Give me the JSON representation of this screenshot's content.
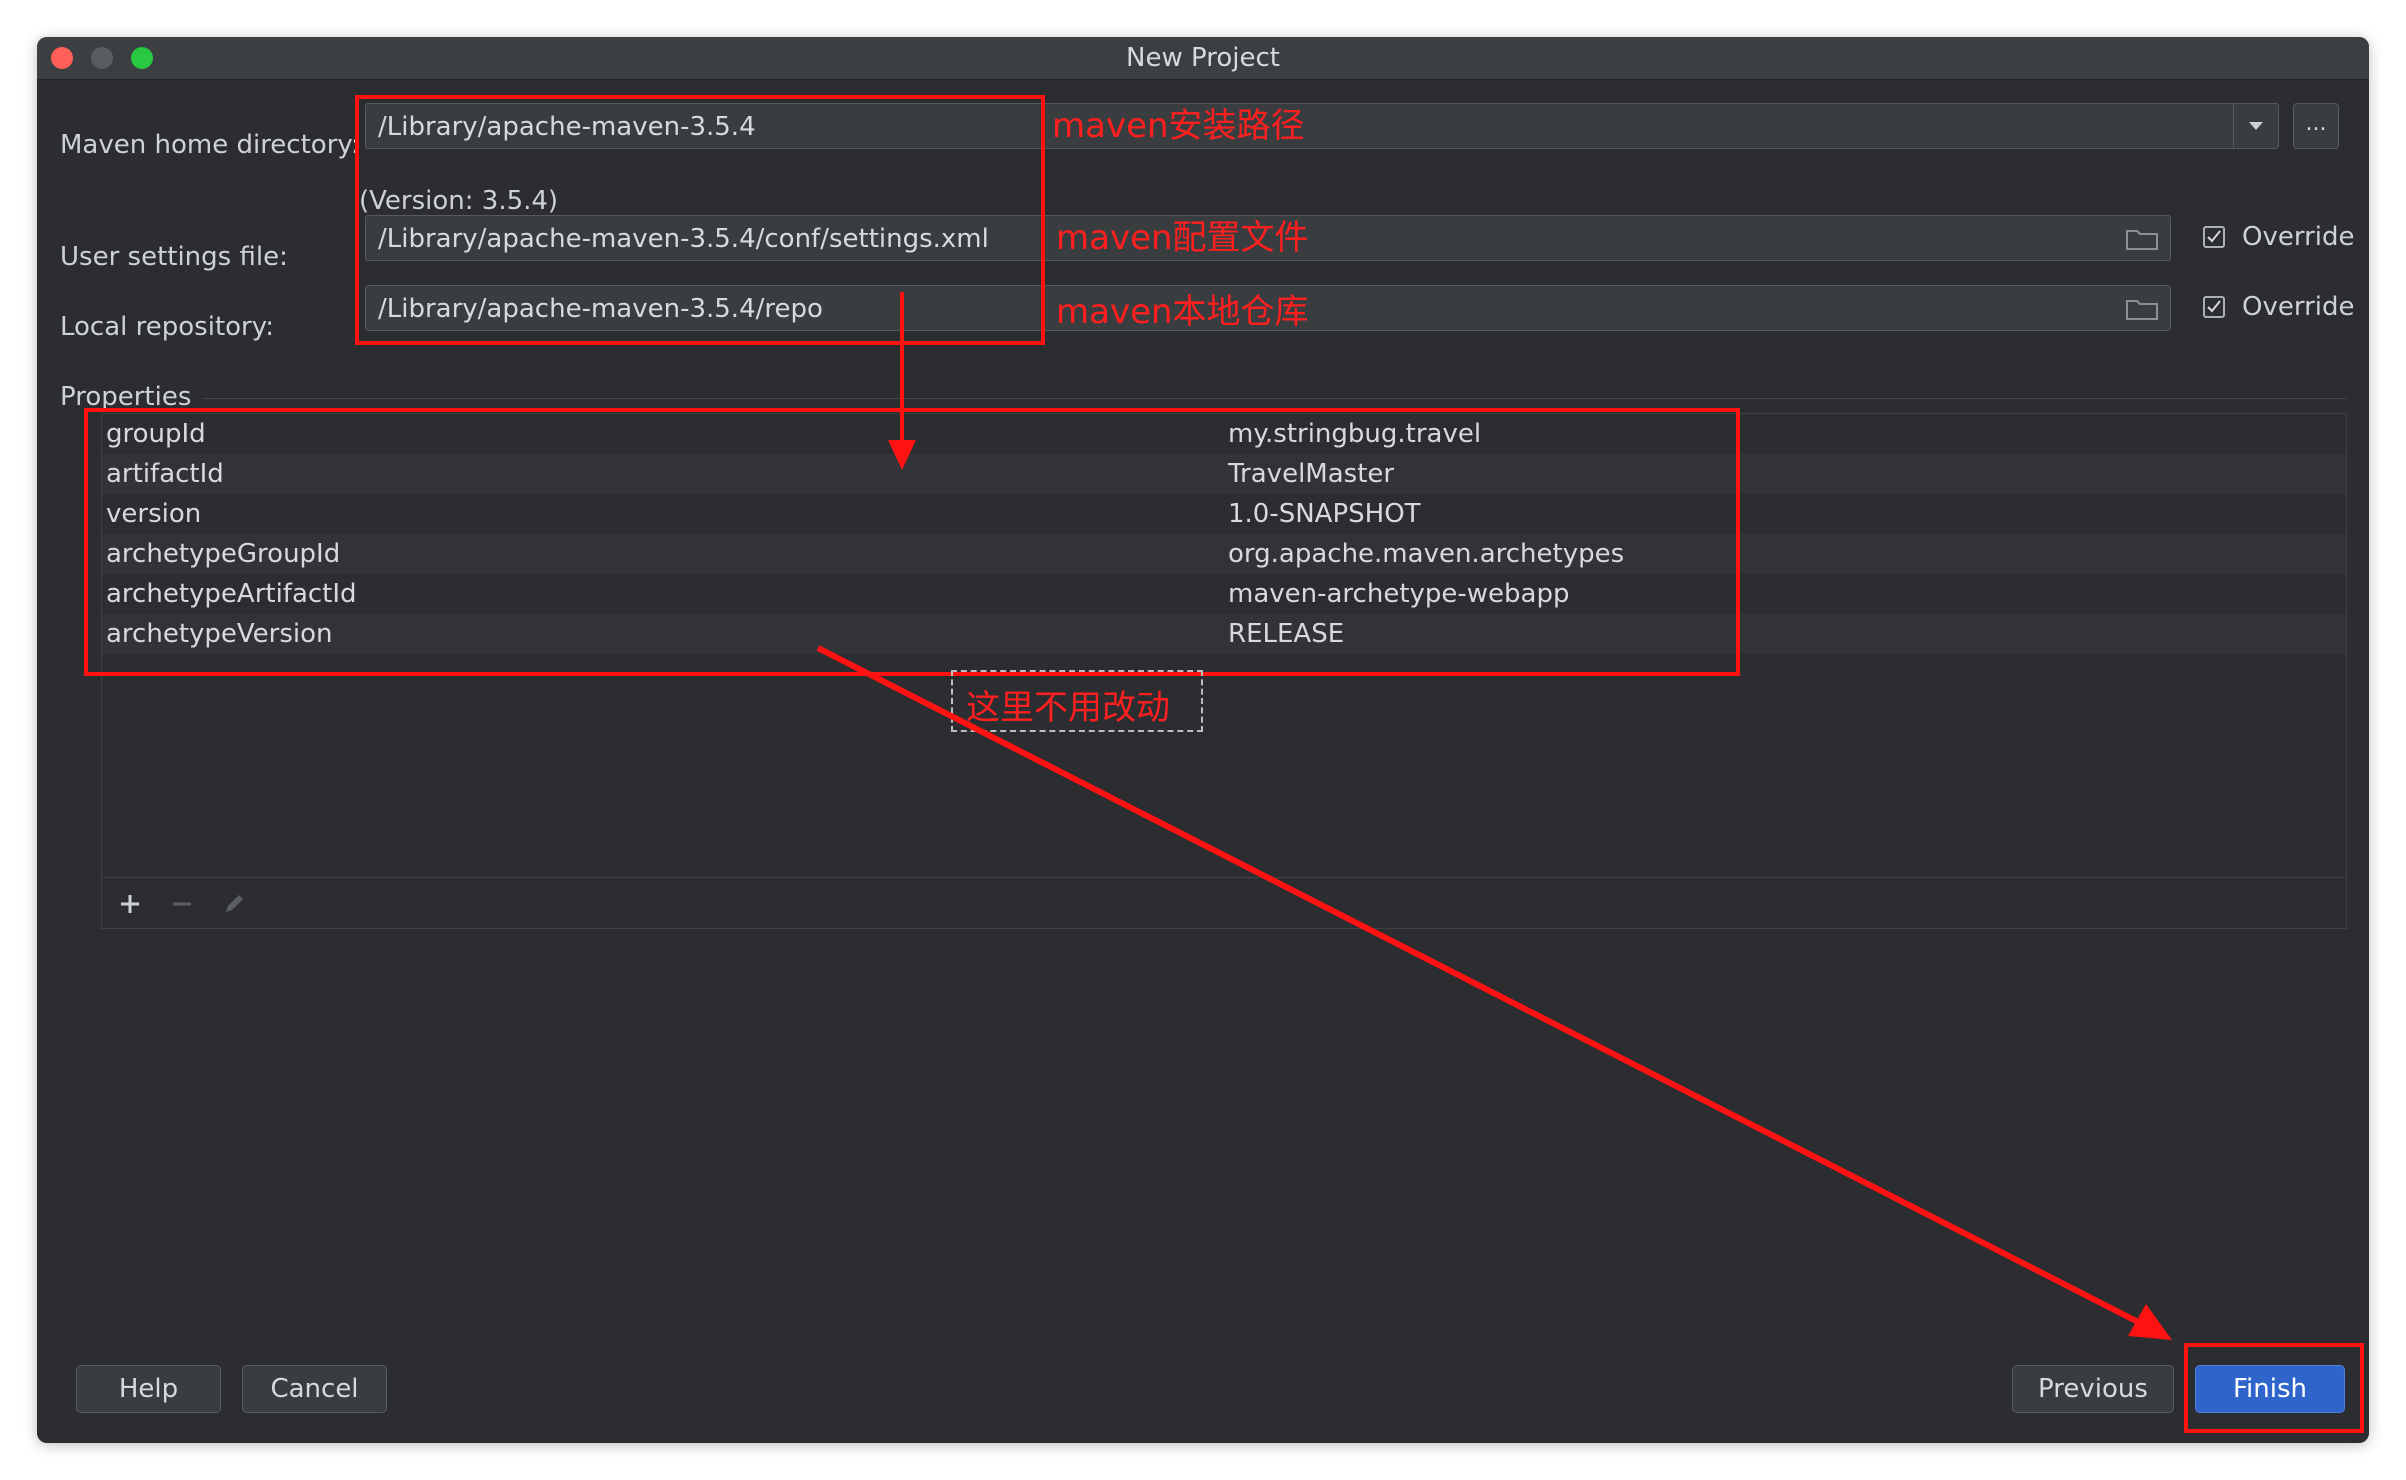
{
  "window": {
    "title": "New Project"
  },
  "form": {
    "maven_home_label": "Maven home directory:",
    "maven_home_value": "/Library/apache-maven-3.5.4",
    "version_text": "(Version: 3.5.4)",
    "browse_label": "...",
    "user_settings_label": "User settings file:",
    "user_settings_value": "/Library/apache-maven-3.5.4/conf/settings.xml",
    "user_settings_override": "Override",
    "local_repo_label": "Local repository:",
    "local_repo_value": "/Library/apache-maven-3.5.4/repo",
    "local_repo_override": "Override"
  },
  "properties": {
    "section_label": "Properties",
    "rows": [
      {
        "key": "groupId",
        "value": "my.stringbug.travel"
      },
      {
        "key": "artifactId",
        "value": "TravelMaster"
      },
      {
        "key": "version",
        "value": "1.0-SNAPSHOT"
      },
      {
        "key": "archetypeGroupId",
        "value": "org.apache.maven.archetypes"
      },
      {
        "key": "archetypeArtifactId",
        "value": "maven-archetype-webapp"
      },
      {
        "key": "archetypeVersion",
        "value": "RELEASE"
      }
    ],
    "tools": [
      "plus-icon",
      "minus-icon",
      "pencil-icon"
    ]
  },
  "footer": {
    "help": "Help",
    "cancel": "Cancel",
    "previous": "Previous",
    "finish": "Finish"
  },
  "annotations": {
    "install_path": "maven安装路径",
    "config_file": "maven配置文件",
    "local_repo": "maven本地仓库",
    "no_change": "这里不用改动"
  },
  "colors": {
    "annotation": "#ff1212",
    "window_bg": "#2b2d30",
    "primary_button": "#2f65ca"
  }
}
